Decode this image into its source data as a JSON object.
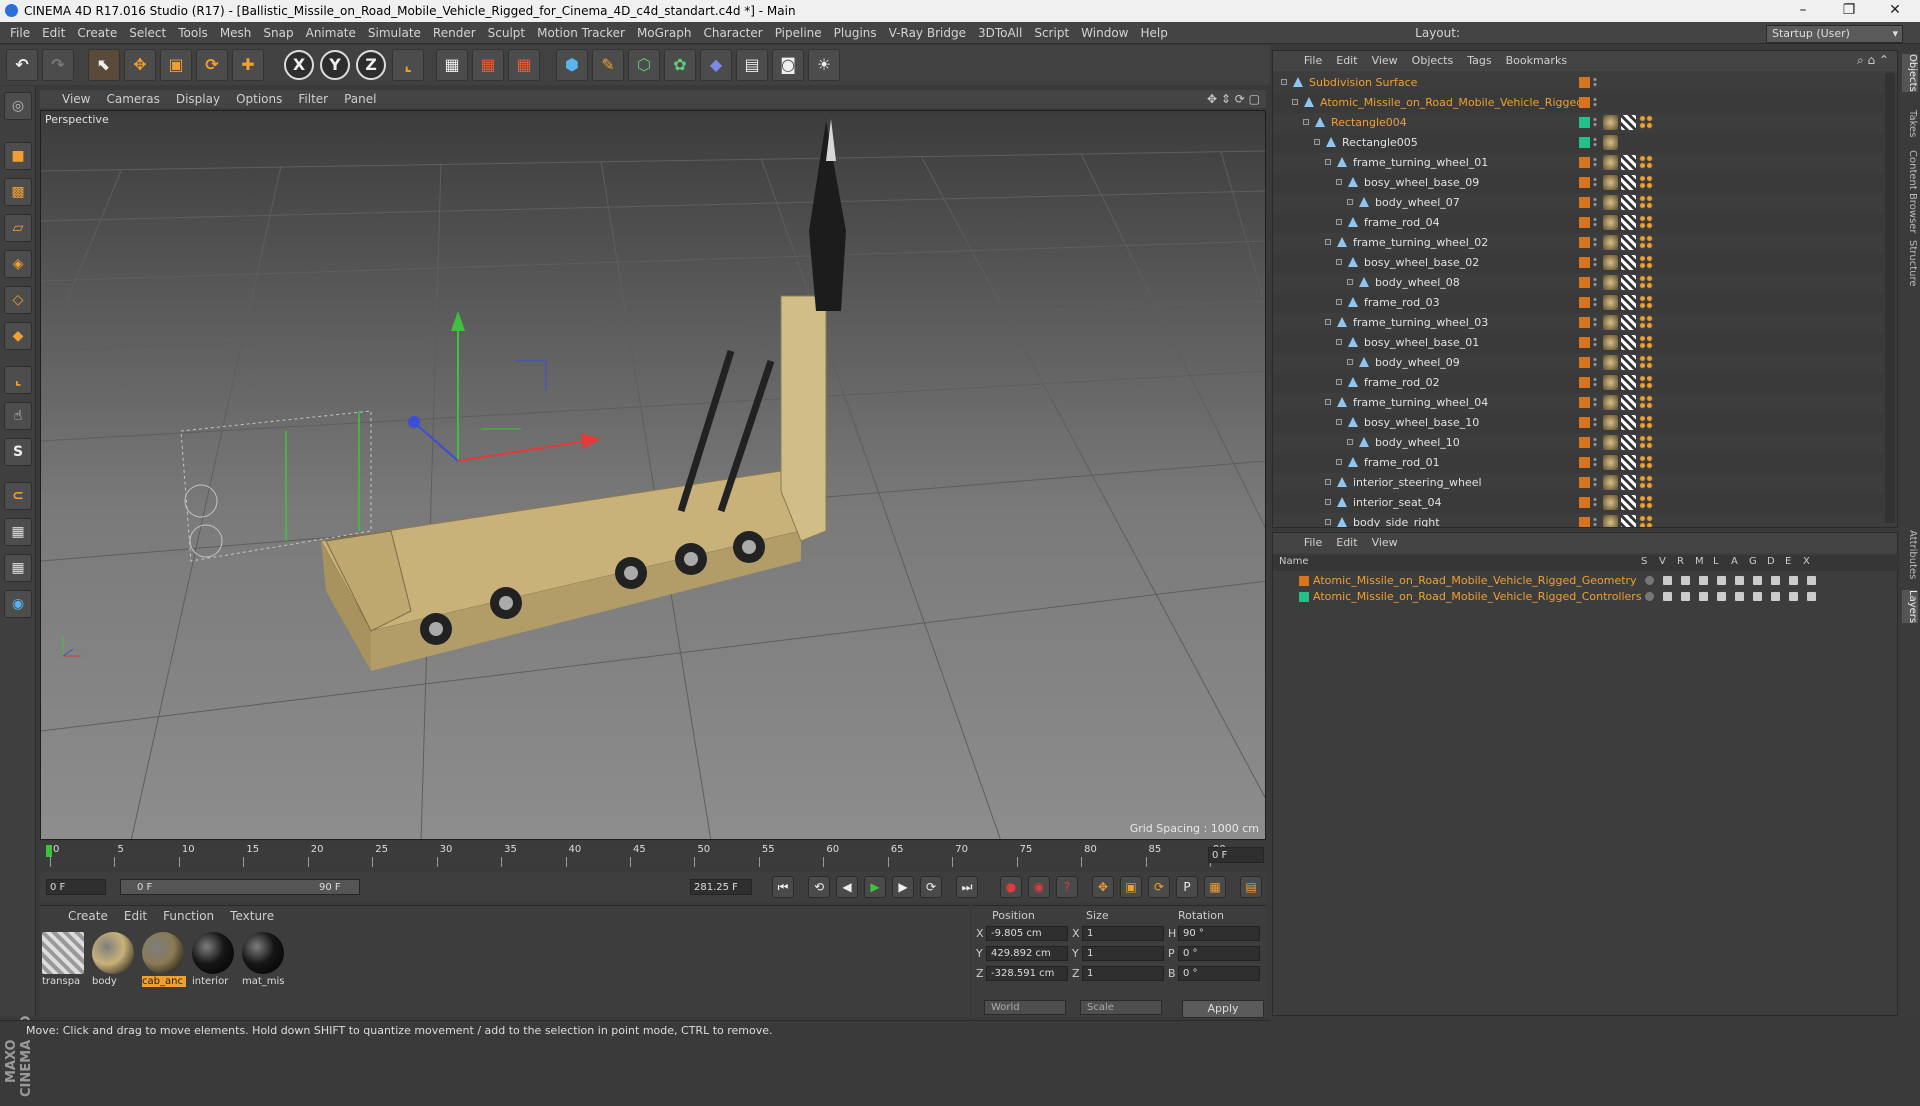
{
  "window": {
    "title": "CINEMA 4D R17.016 Studio (R17) - [Ballistic_Missile_on_Road_Mobile_Vehicle_Rigged_for_Cinema_4D_c4d_standart.c4d *] - Main",
    "minimize": "–",
    "restore": "❐",
    "close": "✕"
  },
  "menubar": {
    "items": [
      "File",
      "Edit",
      "Create",
      "Select",
      "Tools",
      "Mesh",
      "Snap",
      "Animate",
      "Simulate",
      "Render",
      "Sculpt",
      "Motion Tracker",
      "MoGraph",
      "Character",
      "Pipeline",
      "Plugins",
      "V-Ray Bridge",
      "3DToAll",
      "Script",
      "Window",
      "Help"
    ],
    "layout_label": "Layout:",
    "layout_value": "Startup (User)"
  },
  "toolbar": {
    "x_label": "X",
    "y_label": "Y",
    "z_label": "Z"
  },
  "viewport": {
    "menu": [
      "View",
      "Cameras",
      "Display",
      "Options",
      "Filter",
      "Panel"
    ],
    "label": "Perspective",
    "grid_spacing": "Grid Spacing : 1000 cm"
  },
  "timeline": {
    "ticks": [
      "0",
      "5",
      "10",
      "15",
      "20",
      "25",
      "30",
      "35",
      "40",
      "45",
      "50",
      "55",
      "60",
      "65",
      "70",
      "75",
      "80",
      "85",
      "90"
    ],
    "end_frame": "0 F",
    "current_frame": "0 F",
    "range_start": "0 F",
    "range_end": "90 F",
    "fps_field": "281.25 F"
  },
  "materials": {
    "menu": [
      "Create",
      "Edit",
      "Function",
      "Texture"
    ],
    "items": [
      {
        "label": "transpa",
        "color": "#bdbdbd"
      },
      {
        "label": "body",
        "color": "#c9b27a"
      },
      {
        "label": "cab_anc",
        "color": "#8a7a55"
      },
      {
        "label": "interior",
        "color": "#161616"
      },
      {
        "label": "mat_mis",
        "color": "#161616"
      }
    ]
  },
  "coords": {
    "headers": {
      "position": "Position",
      "size": "Size",
      "rotation": "Rotation"
    },
    "rows": [
      {
        "axis": "X",
        "pos": "-9.805 cm",
        "size_axis": "X",
        "size": "1",
        "rot_axis": "H",
        "rot": "90 °"
      },
      {
        "axis": "Y",
        "pos": "429.892 cm",
        "size_axis": "Y",
        "size": "1",
        "rot_axis": "P",
        "rot": "0 °"
      },
      {
        "axis": "Z",
        "pos": "-328.591 cm",
        "size_axis": "Z",
        "size": "1",
        "rot_axis": "B",
        "rot": "0 °"
      }
    ],
    "world": "World",
    "scale": "Scale",
    "apply": "Apply"
  },
  "status": "Move: Click and drag to move elements. Hold down SHIFT to quantize movement / add to the selection in point mode, CTRL to remove.",
  "objects_panel": {
    "menu": [
      "File",
      "Edit",
      "View",
      "Objects",
      "Tags",
      "Bookmarks"
    ],
    "rows": [
      {
        "name": "Subdivision Surface",
        "orange": true
      },
      {
        "name": "Atomic_Missile_on_Road_Mobile_Vehicle_Rigged",
        "orange": true
      },
      {
        "name": "Rectangle004",
        "orange": true
      },
      {
        "name": "Rectangle005",
        "orange": false
      },
      {
        "name": "frame_turning_wheel_01",
        "orange": false
      },
      {
        "name": "bosy_wheel_base_09",
        "orange": false
      },
      {
        "name": "body_wheel_07",
        "orange": false
      },
      {
        "name": "frame_rod_04",
        "orange": false
      },
      {
        "name": "frame_turning_wheel_02",
        "orange": false
      },
      {
        "name": "bosy_wheel_base_02",
        "orange": false
      },
      {
        "name": "body_wheel_08",
        "orange": false
      },
      {
        "name": "frame_rod_03",
        "orange": false
      },
      {
        "name": "frame_turning_wheel_03",
        "orange": false
      },
      {
        "name": "bosy_wheel_base_01",
        "orange": false
      },
      {
        "name": "body_wheel_09",
        "orange": false
      },
      {
        "name": "frame_rod_02",
        "orange": false
      },
      {
        "name": "frame_turning_wheel_04",
        "orange": false
      },
      {
        "name": "bosy_wheel_base_10",
        "orange": false
      },
      {
        "name": "body_wheel_10",
        "orange": false
      },
      {
        "name": "frame_rod_01",
        "orange": false
      },
      {
        "name": "interior_steering_wheel",
        "orange": false
      },
      {
        "name": "interior_seat_04",
        "orange": false
      },
      {
        "name": "body_side_right",
        "orange": false
      }
    ]
  },
  "right_tabs": [
    "Objects",
    "Takes",
    "Content Browser",
    "Structure",
    "Attributes",
    "Layers"
  ],
  "layers_panel": {
    "menu": [
      "File",
      "Edit",
      "View"
    ],
    "headers": [
      "Name",
      "S",
      "V",
      "R",
      "M",
      "L",
      "A",
      "G",
      "D",
      "E",
      "X"
    ],
    "rows": [
      {
        "name": "Atomic_Missile_on_Road_Mobile_Vehicle_Rigged_Geometry",
        "color": "#d8731e"
      },
      {
        "name": "Atomic_Missile_on_Road_Mobile_Vehicle_Rigged_Controllers",
        "color": "#23c08a"
      }
    ]
  }
}
